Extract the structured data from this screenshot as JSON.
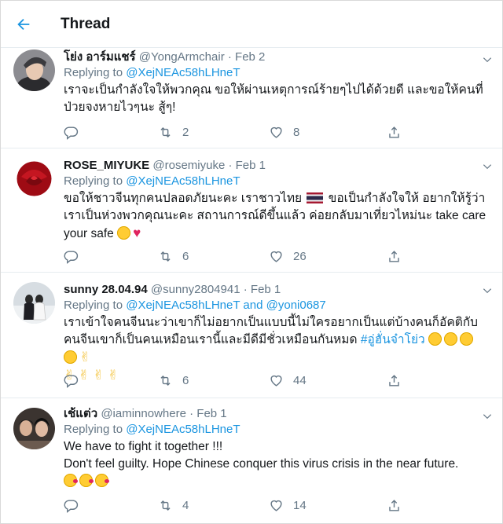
{
  "header": {
    "title": "Thread"
  },
  "colors": {
    "accent": "#1b95e0",
    "secondary_text": "#657786",
    "like": "#e0245e"
  },
  "tweets": [
    {
      "name": "โย่ง อาร์มแชร์",
      "handle": "@YongArmchair",
      "dot": "·",
      "date": "Feb 2",
      "replying_prefix": "Replying to ",
      "replying_to": "@XejNEAc58hLHneT",
      "text": "เราจะเป็นกำลังใจให้พวกคุณ ขอให้ผ่านเหตุการณ์ร้ายๆไปได้ด้วยดี และขอให้คนที่ป่วยจงหายไวๆนะ สู้ๆ!",
      "replies": "",
      "retweets": "2",
      "likes": "8"
    },
    {
      "name": "ROSE_MIYUKE",
      "handle": "@rosemiyuke",
      "dot": "·",
      "date": "Feb 1",
      "replying_prefix": "Replying to ",
      "replying_to": "@XejNEAc58hLHneT",
      "text_a": "ขอให้ชาวจีนทุกคนปลอดภัยนะคะ เราชาวไทย",
      "text_b": "ขอเป็นกำลังใจให้ อยากให้รู้ว่า เราเป็นห่วงพวกคุณนะคะ สถานการณ์ดีขึ้นแล้ว ค่อยกลับมาเที่ยวไหม่นะ take care your safe",
      "replies": "",
      "retweets": "6",
      "likes": "26"
    },
    {
      "name": "sunny 28.04.94",
      "handle": "@sunny2804941",
      "dot": "·",
      "date": "Feb 1",
      "replying_prefix": "Replying to ",
      "replying_to": "@XejNEAc58hLHneT",
      "replying_and": " and ",
      "replying_to_2": "@yoni0687",
      "text": "เราเข้าใจคนจีนนะว่าเขาก็ไม่อยากเป็นแบบนี้ไม่ใครอยากเป็นแต่บ้างคนก็อัคติกับคนจีนเขาก็เป็นคนเหมือนเรานี้และมีดีมีชั่วเหมือนกันหมด ",
      "hashtag": "#อู่ฮั่นจ๋าโย่ว",
      "replies": "",
      "retweets": "6",
      "likes": "44"
    },
    {
      "name": "เช้แต่ว",
      "handle": "@iaminnowhere",
      "dot": "·",
      "date": "Feb 1",
      "replying_prefix": "Replying to ",
      "replying_to": "@XejNEAc58hLHneT",
      "line1": "We have to fight it together !!!",
      "line2": "Don't feel guilty. Hope Chinese conquer this virus crisis in the near future.",
      "replies": "",
      "retweets": "4",
      "likes": "14"
    }
  ],
  "icons": [
    "back-arrow-icon",
    "chevron-down-icon",
    "reply-icon",
    "retweet-icon",
    "heart-icon",
    "share-icon",
    "emoji-icon",
    "thai-flag-icon"
  ]
}
